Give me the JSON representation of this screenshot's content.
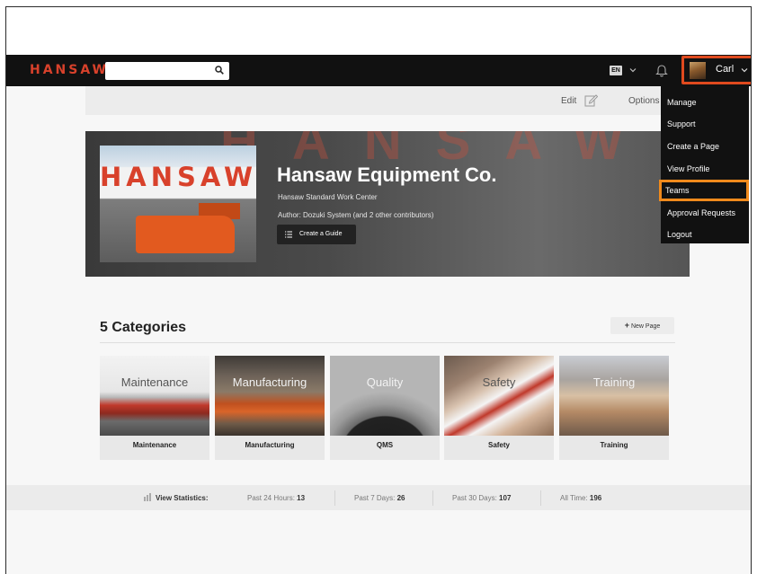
{
  "header": {
    "logo": "HANSAW",
    "search_placeholder": "",
    "lang": "EN",
    "user_name": "Carl"
  },
  "toolbar": {
    "edit_label": "Edit",
    "options_label": "Options"
  },
  "hero": {
    "bg_letters": "HANSAW",
    "thumb_word": "HANSAW",
    "title": "Hansaw Equipment Co.",
    "subtitle": "Hansaw Standard Work Center",
    "author": "Author: Dozuki System (and 2 other contributors)",
    "create_guide_label": "Create a Guide"
  },
  "user_menu": {
    "items": [
      {
        "label": "Manage"
      },
      {
        "label": "Support"
      },
      {
        "label": "Create a Page"
      },
      {
        "label": "View Profile"
      },
      {
        "label": "Teams",
        "highlighted": true
      },
      {
        "label": "Approval Requests"
      },
      {
        "label": "Logout"
      }
    ],
    "highlight_color": "#f08a1c"
  },
  "categories": {
    "title": "5 Categories",
    "new_page_label": "New Page",
    "new_page_icon": "+",
    "cards": [
      {
        "image_word": "Maintenance",
        "label": "Maintenance"
      },
      {
        "image_word": "Manufacturing",
        "label": "Manufacturing"
      },
      {
        "image_word": "Quality",
        "label": "QMS"
      },
      {
        "image_word": "Safety",
        "label": "Safety"
      },
      {
        "image_word": "Training",
        "label": "Training"
      }
    ]
  },
  "stats": {
    "label": "View Statistics:",
    "past_24_label": "Past 24 Hours:",
    "past_24_value": "13",
    "past_7_label": "Past 7 Days:",
    "past_7_value": "26",
    "past_30_label": "Past 30 Days:",
    "past_30_value": "107",
    "all_time_label": "All Time:",
    "all_time_value": "196"
  },
  "colors": {
    "brand_red": "#d8412b",
    "user_highlight": "#e04a1e",
    "topbar": "#111111"
  }
}
